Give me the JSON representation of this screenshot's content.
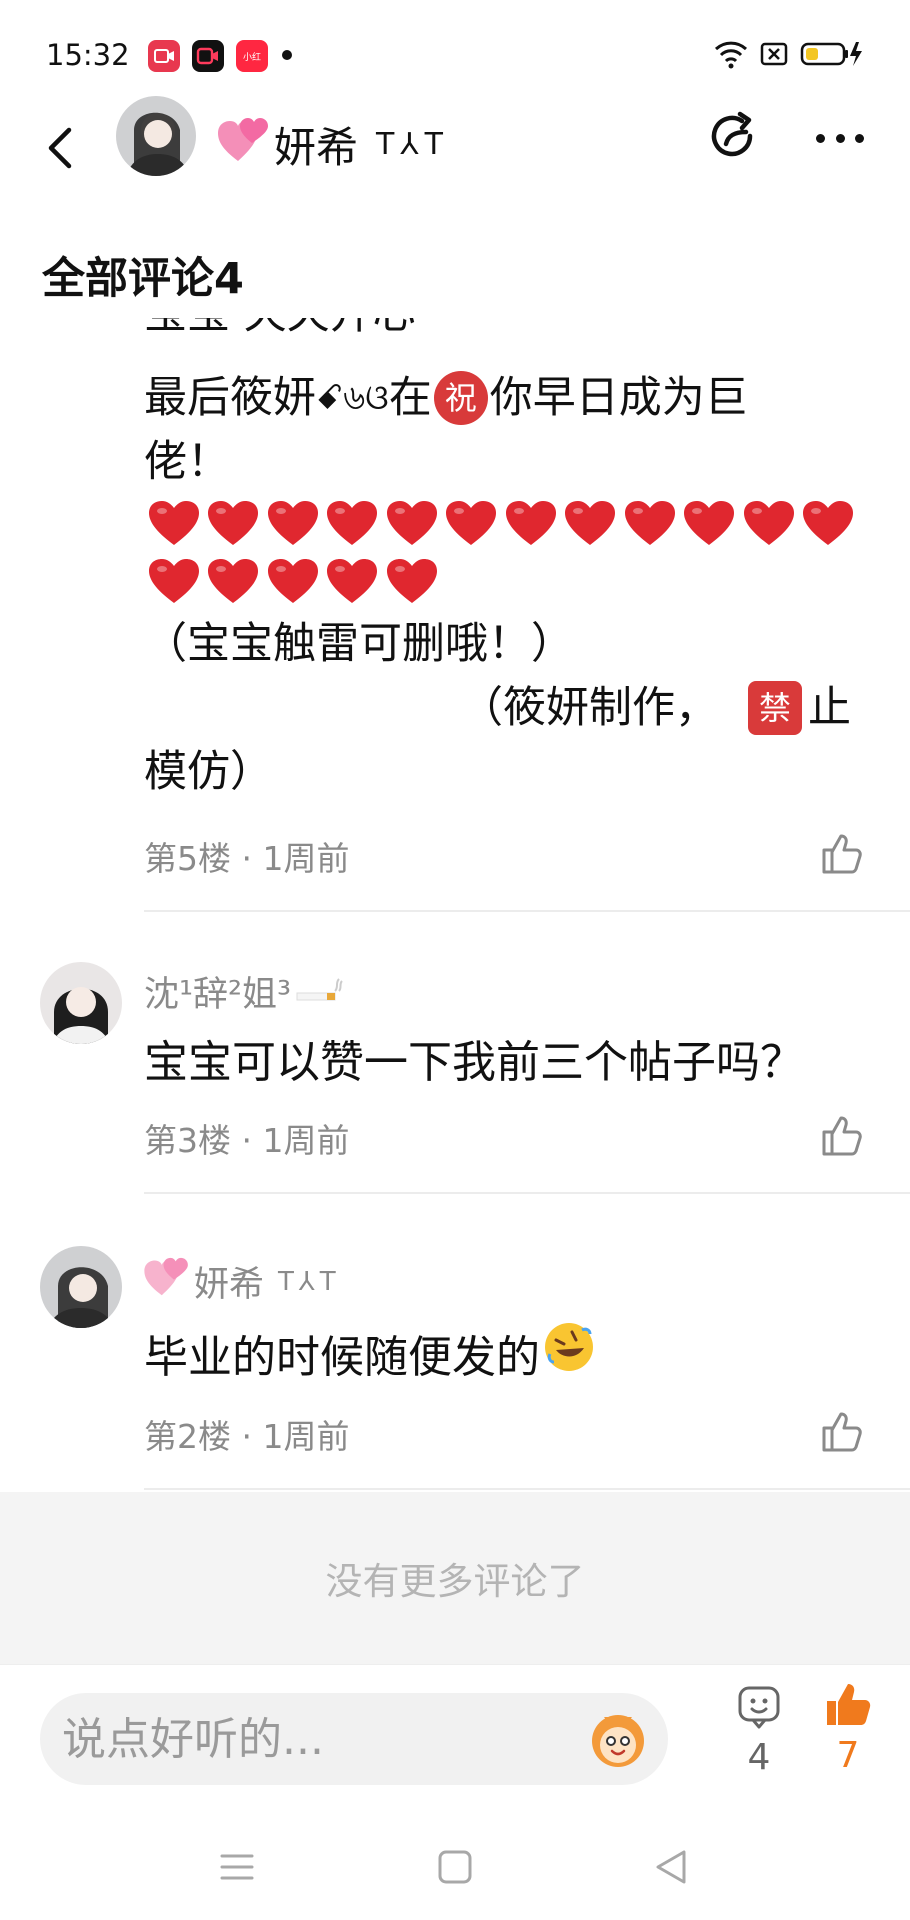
{
  "status_bar": {
    "time": "15:32"
  },
  "header": {
    "name": "妍希",
    "name_suffix": "T⅄T"
  },
  "section_title": "全部评论4",
  "comments": [
    {
      "body_cut": "宝宝 天天开心",
      "body_line1": "最后筱妍",
      "body_line1_symbol": "ꗃ৬ଓ",
      "body_line1_b": "在",
      "body_line1_c": "你早日成为巨",
      "body_line2": "佬！",
      "hearts_count": 17,
      "note1": "（宝宝触雷可删哦！）",
      "note2": "（筱妍制作，",
      "note2_b": "止",
      "note3": "模仿）",
      "blessing_char": "祝",
      "prohibit_char": "禁",
      "meta": "第5楼 · 1周前"
    },
    {
      "user": "沈¹辞²姐³",
      "text": "宝宝可以赞一下我前三个帖子吗？",
      "meta": "第3楼 · 1周前"
    },
    {
      "user": "妍希",
      "user_suffix": "T⅄T",
      "text": "毕业的时候随便发的",
      "meta": "第2楼 · 1周前"
    }
  ],
  "no_more": "没有更多评论了",
  "input": {
    "placeholder": "说点好听的..."
  },
  "comment_count": "4",
  "like_count": "7",
  "colors": {
    "accent_orange": "#f07a1d",
    "heart_red": "#e0272f"
  }
}
